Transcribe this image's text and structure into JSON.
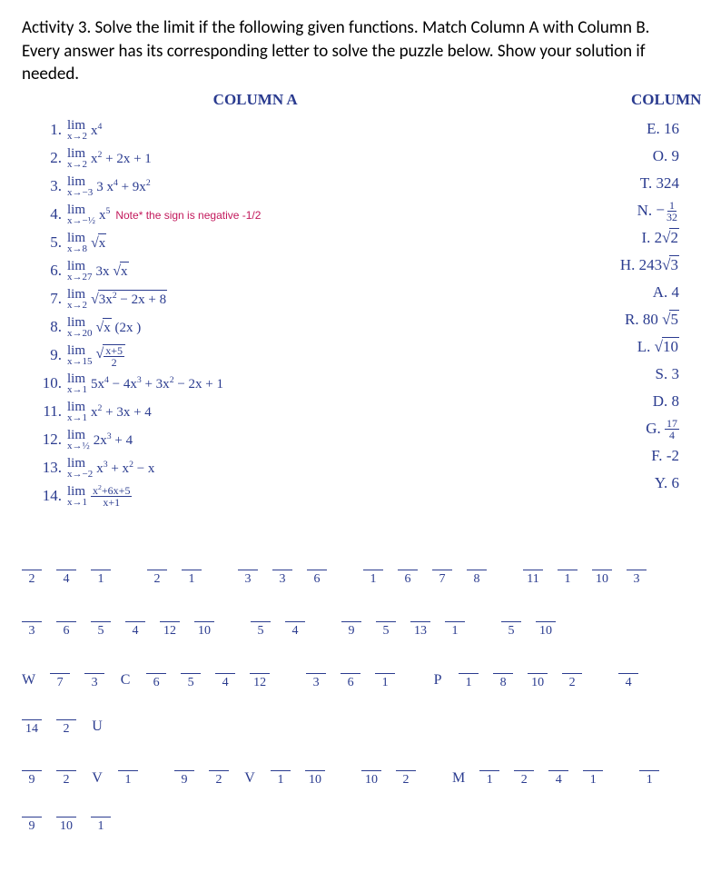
{
  "instructions": "Activity 3. Solve the limit if the following given functions. Match Column A with Column B. Every answer has its corresponding letter to solve the puzzle below. Show your solution if needed.",
  "headers": {
    "colA": "COLUMN A",
    "colB": "COLUMN B"
  },
  "colA": [
    {
      "n": "1.",
      "approach": "x→2",
      "func_html": "x<sup>4</sup>"
    },
    {
      "n": "2.",
      "approach": "x→2",
      "func_html": "x<sup>2</sup> + 2x + 1"
    },
    {
      "n": "3.",
      "approach": "x→−3",
      "func_html": "3 x<sup>4</sup> + 9x<sup>2</sup>"
    },
    {
      "n": "4.",
      "approach": "x→−½",
      "func_html": "x<sup>5</sup>",
      "note": "Note* the sign is negative -1/2"
    },
    {
      "n": "5.",
      "approach": "x→8",
      "sqrt_html": "x"
    },
    {
      "n": "6.",
      "approach": "x→27",
      "pre": "3x ",
      "sqrt_html": "x"
    },
    {
      "n": "7.",
      "approach": "x→2",
      "sqrt_html": "3x<sup>2</sup> − 2x + 8"
    },
    {
      "n": "8.",
      "approach": "x→20",
      "sqrt_html": "x",
      "post": " (2x )"
    },
    {
      "n": "9.",
      "approach": "x→15",
      "sqrtfrac": {
        "top": "x+5",
        "bot": "2"
      }
    },
    {
      "n": "10.",
      "approach": "x→1",
      "func_html": "5x<sup>4</sup> − 4x<sup>3</sup> + 3x<sup>2</sup> − 2x + 1"
    },
    {
      "n": "11.",
      "approach": "x→1",
      "func_html": "x<sup>2</sup> + 3x + 4"
    },
    {
      "n": "12.",
      "approach": "x→½",
      "func_html": "2x<sup>3</sup> + 4"
    },
    {
      "n": "13.",
      "approach": "x→−2",
      "func_html": "x<sup>3</sup> + x<sup>2</sup> − x"
    },
    {
      "n": "14.",
      "approach": "x→1",
      "fracfunc": {
        "top": "x<sup>2</sup>+6x+5",
        "bot": "x+1"
      }
    }
  ],
  "colB": [
    {
      "l": "E.",
      "v_html": "16"
    },
    {
      "l": "O.",
      "v_html": "9"
    },
    {
      "l": "T.",
      "v_html": "324"
    },
    {
      "l": "N.",
      "frac": {
        "pre": "−",
        "top": "1",
        "bot": "32"
      }
    },
    {
      "l": "I.",
      "v_html": "2√<span class='sqrt'>2</span>"
    },
    {
      "l": "H.",
      "v_html": "243√<span class='sqrt'>3</span>"
    },
    {
      "l": "A.",
      "v_html": "4"
    },
    {
      "l": "R.",
      "v_html": "80 √<span class='sqrt'>5</span>"
    },
    {
      "l": "L.",
      "v_html": "√<span class='sqrt'>10</span>"
    },
    {
      "l": "S.",
      "v_html": "3"
    },
    {
      "l": "D.",
      "v_html": "8"
    },
    {
      "l": "G.",
      "frac": {
        "top": "17",
        "bot": "4"
      }
    },
    {
      "l": "F.",
      "v_html": "-2"
    },
    {
      "l": "Y.",
      "v_html": "6"
    }
  ],
  "puzzle": [
    [
      {
        "b": true,
        "n": "2"
      },
      {
        "b": true,
        "n": "4"
      },
      {
        "b": true,
        "n": "1"
      },
      {
        "gap": true
      },
      {
        "b": true,
        "n": "2"
      },
      {
        "b": true,
        "n": "1"
      },
      {
        "gap": true
      },
      {
        "b": true,
        "n": "3"
      },
      {
        "b": true,
        "n": "3"
      },
      {
        "b": true,
        "n": "6"
      },
      {
        "gap": true
      },
      {
        "b": true,
        "n": "1"
      },
      {
        "b": true,
        "n": "6"
      },
      {
        "b": true,
        "n": "7"
      },
      {
        "b": true,
        "n": "8"
      },
      {
        "gap": true
      },
      {
        "b": true,
        "n": "11"
      },
      {
        "b": true,
        "n": "1"
      },
      {
        "b": true,
        "n": "10"
      },
      {
        "b": true,
        "n": "3"
      }
    ],
    [
      {
        "b": true,
        "n": "3"
      },
      {
        "b": true,
        "n": "6"
      },
      {
        "b": true,
        "n": "5"
      },
      {
        "b": true,
        "n": "4"
      },
      {
        "b": true,
        "n": "12"
      },
      {
        "b": true,
        "n": "10"
      },
      {
        "gap": true
      },
      {
        "b": true,
        "n": "5"
      },
      {
        "b": true,
        "n": "4"
      },
      {
        "gap": true
      },
      {
        "b": true,
        "n": "9"
      },
      {
        "b": true,
        "n": "5"
      },
      {
        "b": true,
        "n": "13"
      },
      {
        "b": true,
        "n": "1"
      },
      {
        "gap": true
      },
      {
        "b": true,
        "n": "5"
      },
      {
        "b": true,
        "n": "10"
      }
    ],
    [
      {
        "pre": "W"
      },
      {
        "b": true,
        "n": "7"
      },
      {
        "b": true,
        "n": "3"
      },
      {
        "pre": "C"
      },
      {
        "b": true,
        "n": "6"
      },
      {
        "b": true,
        "n": "5"
      },
      {
        "b": true,
        "n": "4"
      },
      {
        "b": true,
        "n": "12"
      },
      {
        "gap": true
      },
      {
        "b": true,
        "n": "3"
      },
      {
        "b": true,
        "n": "6"
      },
      {
        "b": true,
        "n": "1"
      },
      {
        "gap": true
      },
      {
        "pre": "P"
      },
      {
        "b": true,
        "n": "1"
      },
      {
        "b": true,
        "n": "8"
      },
      {
        "b": true,
        "n": "10"
      },
      {
        "b": true,
        "n": "2"
      },
      {
        "gap": true
      },
      {
        "b": true,
        "n": "4"
      },
      {
        "gap": true
      },
      {
        "b": true,
        "n": "14"
      },
      {
        "b": true,
        "n": "2"
      },
      {
        "pre": "U"
      }
    ],
    [
      {
        "b": true,
        "n": "9"
      },
      {
        "b": true,
        "n": "2"
      },
      {
        "pre": "V"
      },
      {
        "b": true,
        "n": "1"
      },
      {
        "gap": true
      },
      {
        "b": true,
        "n": "9"
      },
      {
        "b": true,
        "n": "2"
      },
      {
        "pre": "V"
      },
      {
        "b": true,
        "n": "1"
      },
      {
        "b": true,
        "n": "10"
      },
      {
        "gap": true
      },
      {
        "b": true,
        "n": "10"
      },
      {
        "b": true,
        "n": "2"
      },
      {
        "gap": true
      },
      {
        "pre": "M"
      },
      {
        "b": true,
        "n": "1"
      },
      {
        "b": true,
        "n": "2"
      },
      {
        "b": true,
        "n": "4"
      },
      {
        "b": true,
        "n": "1"
      },
      {
        "gap": true
      },
      {
        "b": true,
        "n": "1"
      },
      {
        "b": true,
        "n": "9"
      },
      {
        "b": true,
        "n": "10"
      },
      {
        "b": true,
        "n": "1"
      }
    ]
  ]
}
